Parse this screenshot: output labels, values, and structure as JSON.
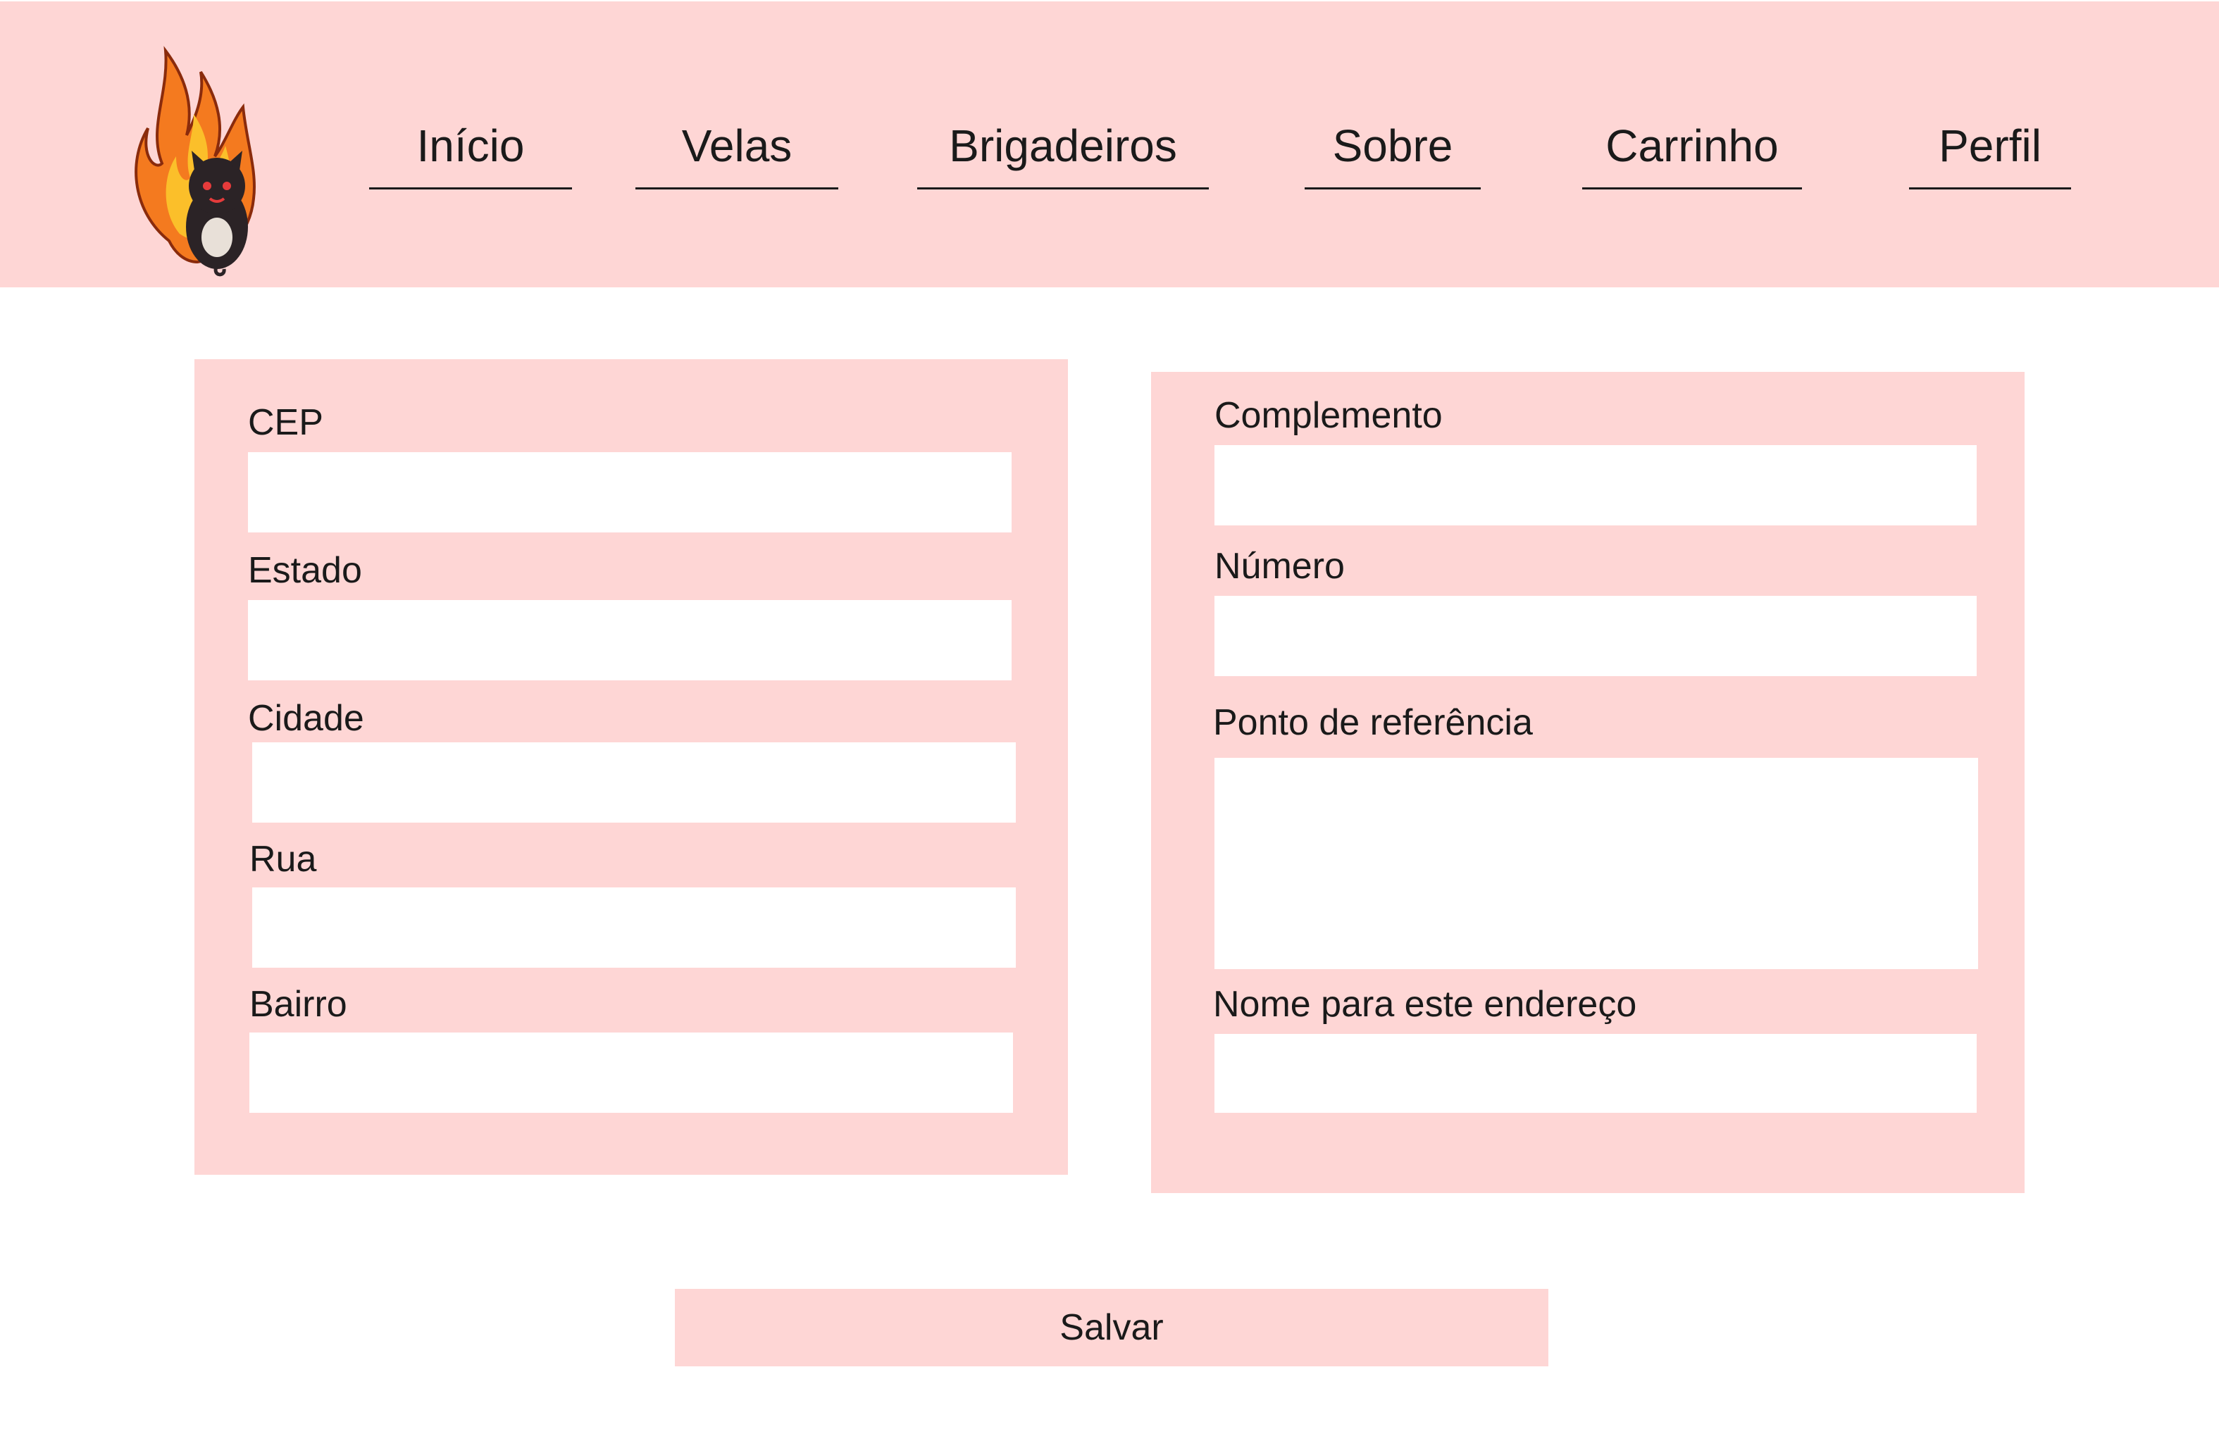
{
  "colors": {
    "accent_pink": "#fed6d5",
    "background": "#ffffff",
    "text": "#1a1a1a",
    "logo_flame": "#f47a1f",
    "logo_creature": "#2b2326"
  },
  "header": {
    "logo_icon": "flaming-cat-mascot-logo",
    "nav": [
      {
        "label": "Início"
      },
      {
        "label": "Velas"
      },
      {
        "label": "Brigadeiros"
      },
      {
        "label": "Sobre"
      },
      {
        "label": "Carrinho"
      },
      {
        "label": "Perfil"
      }
    ]
  },
  "form_left": {
    "fields": [
      {
        "label": "CEP",
        "value": ""
      },
      {
        "label": "Estado",
        "value": ""
      },
      {
        "label": "Cidade",
        "value": ""
      },
      {
        "label": "Rua",
        "value": ""
      },
      {
        "label": "Bairro",
        "value": ""
      }
    ]
  },
  "form_right": {
    "fields": [
      {
        "label": "Complemento",
        "value": ""
      },
      {
        "label": "Número",
        "value": ""
      },
      {
        "label": "Ponto de referência",
        "value": ""
      },
      {
        "label": "Nome para este endereço",
        "value": ""
      }
    ]
  },
  "actions": {
    "save_label": "Salvar"
  }
}
